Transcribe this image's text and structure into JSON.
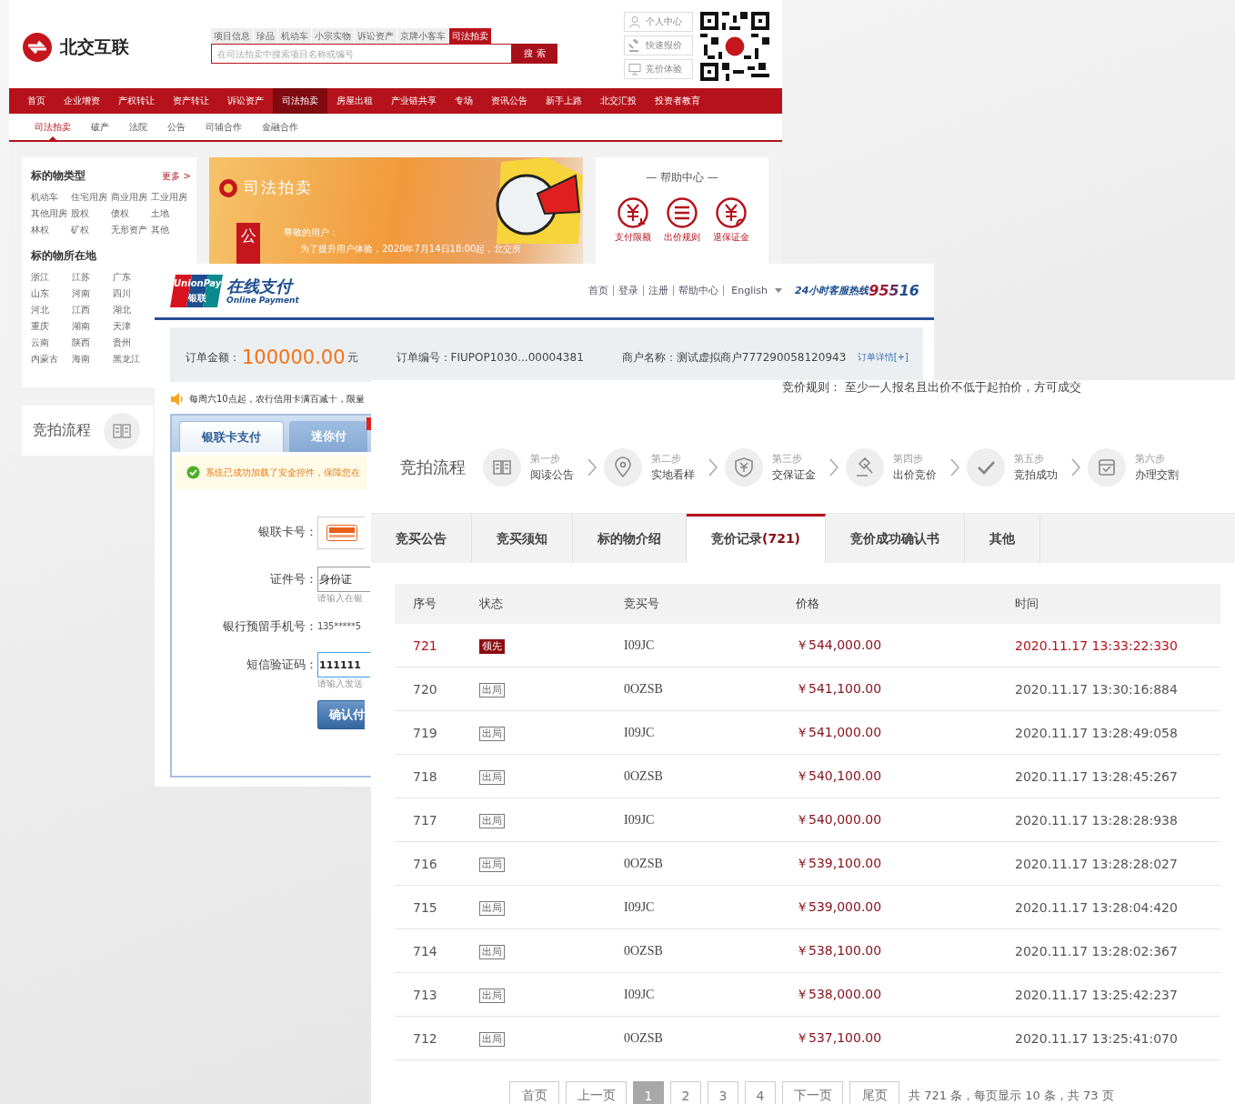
{
  "beijiao": {
    "logo": "北交互联",
    "search_tabs": [
      {
        "label": "项目信息",
        "selected": false
      },
      {
        "label": "珍品",
        "selected": false
      },
      {
        "label": "机动车",
        "selected": false
      },
      {
        "label": "小宗实物",
        "selected": false
      },
      {
        "label": "诉讼资产",
        "selected": false
      },
      {
        "label": "京牌小客车",
        "selected": false
      },
      {
        "label": "司法拍卖",
        "selected": true
      }
    ],
    "search": {
      "placeholder": "在司法拍卖中搜索项目名称或编号",
      "button": "搜 索"
    },
    "user_links": [
      {
        "label": "个人中心",
        "kind": "person"
      },
      {
        "label": "快速报价",
        "kind": "gavel"
      },
      {
        "label": "竞价体验",
        "kind": "monitor"
      }
    ],
    "nav": [
      {
        "label": "首页",
        "selected": false
      },
      {
        "label": "企业增资",
        "selected": false
      },
      {
        "label": "产权转让",
        "selected": false
      },
      {
        "label": "资产转让",
        "selected": false
      },
      {
        "label": "诉讼资产",
        "selected": false
      },
      {
        "label": "司法拍卖",
        "selected": true
      },
      {
        "label": "房屋出租",
        "selected": false
      },
      {
        "label": "产业链共享",
        "selected": false
      },
      {
        "label": "专场",
        "selected": false
      },
      {
        "label": "资讯公告",
        "selected": false
      },
      {
        "label": "新手上路",
        "selected": false
      },
      {
        "label": "北交汇投",
        "selected": false
      },
      {
        "label": "投资者教育",
        "selected": false
      }
    ],
    "subnav": [
      {
        "label": "司法拍卖",
        "selected": true
      },
      {
        "label": "破产",
        "selected": false
      },
      {
        "label": "法院",
        "selected": false
      },
      {
        "label": "公告",
        "selected": false
      },
      {
        "label": "司辅合作",
        "selected": false
      },
      {
        "label": "金融合作",
        "selected": false
      }
    ],
    "sidebar": {
      "types_title": "标的物类型",
      "more": "更多 >",
      "types": [
        "机动车",
        "住宅用房",
        "商业用房",
        "工业用房",
        "其他用房",
        "股权",
        "债权",
        "土地",
        "林权",
        "矿权",
        "无形资产",
        "其他"
      ],
      "location_title": "标的物所在地",
      "locations": [
        "浙江",
        "江苏",
        "广东",
        "山东",
        "河南",
        "四川",
        "河北",
        "江西",
        "湖北",
        "重庆",
        "湖南",
        "天津",
        "云南",
        "陕西",
        "贵州",
        "内蒙古",
        "海南",
        "黑龙江"
      ],
      "process_title": "竞拍流程"
    },
    "banner": {
      "title": "司法拍卖",
      "notice_tag": "公",
      "greeting": "尊敬的用户：",
      "message": "为了提升用户体验，2020年7月14日18:00起，北交所"
    },
    "help": {
      "title": "— 帮助中心 —",
      "items": [
        {
          "label": "支付限额",
          "kind": "yuan-down"
        },
        {
          "label": "出价规则",
          "kind": "list"
        },
        {
          "label": "退保证金",
          "kind": "yuan-return"
        }
      ]
    }
  },
  "unionpay": {
    "logo_brand": "UnionPay",
    "logo_cn": "银联",
    "title": "在线支付",
    "subtitle": "Online Payment",
    "nav": [
      "首页",
      "登录",
      "注册",
      "帮助中心"
    ],
    "language": "English",
    "hotline_label": "24小时客服热线",
    "hotline": "95516",
    "order": {
      "amount_label": "订单金额：",
      "amount": "100000.00",
      "unit": "元",
      "number_label": "订单编号：",
      "number": "FIUPOP1030...00004381",
      "merchant_label": "商户名称：",
      "merchant": "测试虚拟商户777290058120943",
      "details": "订单详情[+]"
    },
    "promo": "每周六10点起，农行信用卡满百减十，限量",
    "pay_tabs": [
      {
        "label": "银联卡支付",
        "selected": true
      },
      {
        "label": "迷你付",
        "selected": false
      }
    ],
    "security_notice": "系统已成功加载了安全控件，保障您在",
    "form": [
      {
        "kind": "card",
        "label": "银联卡号："
      },
      {
        "kind": "input",
        "label": "证件号：",
        "value": "身份证",
        "hint": "请输入在银",
        "focused": false
      },
      {
        "kind": "text",
        "label": "银行预留手机号：",
        "value": "135*****5"
      },
      {
        "kind": "input",
        "label": "短信验证码：",
        "value": "111111",
        "hint": "请输入发送",
        "focused": true
      }
    ],
    "confirm": "确认付"
  },
  "auction": {
    "rule_label": "竞价规则：",
    "rule": "至少一人报名且出价不低于起拍价，方可成交",
    "process_title": "竞拍流程",
    "steps": [
      {
        "step": "第一步",
        "label": "阅读公告",
        "kind": "book"
      },
      {
        "step": "第二步",
        "label": "实地看样",
        "kind": "pin"
      },
      {
        "step": "第三步",
        "label": "交保证金",
        "kind": "shield"
      },
      {
        "step": "第四步",
        "label": "出价竞价",
        "kind": "gavel"
      },
      {
        "step": "第五步",
        "label": "竞拍成功",
        "kind": "check"
      },
      {
        "step": "第六步",
        "label": "办理交割",
        "kind": "box"
      }
    ],
    "tabs": [
      {
        "label": "竞买公告",
        "selected": false
      },
      {
        "label": "竞买须知",
        "selected": false
      },
      {
        "label": "标的物介绍",
        "selected": false
      },
      {
        "label": "竞价记录",
        "count": "(721)",
        "selected": true
      },
      {
        "label": "竞价成功确认书",
        "selected": false
      },
      {
        "label": "其他",
        "selected": false
      }
    ],
    "table": {
      "columns": [
        "序号",
        "状态",
        "竞买号",
        "价格",
        "时间"
      ],
      "rows": [
        {
          "no": "721",
          "status": "领先",
          "leading": true,
          "bidder": "I09JC",
          "price": "￥544,000.00",
          "time": "2020.11.17 13:33:22:330"
        },
        {
          "no": "720",
          "status": "出局",
          "leading": false,
          "bidder": "0OZSB",
          "price": "￥541,100.00",
          "time": "2020.11.17 13:30:16:884"
        },
        {
          "no": "719",
          "status": "出局",
          "leading": false,
          "bidder": "I09JC",
          "price": "￥541,000.00",
          "time": "2020.11.17 13:28:49:058"
        },
        {
          "no": "718",
          "status": "出局",
          "leading": false,
          "bidder": "0OZSB",
          "price": "￥540,100.00",
          "time": "2020.11.17 13:28:45:267"
        },
        {
          "no": "717",
          "status": "出局",
          "leading": false,
          "bidder": "I09JC",
          "price": "￥540,000.00",
          "time": "2020.11.17 13:28:28:938"
        },
        {
          "no": "716",
          "status": "出局",
          "leading": false,
          "bidder": "0OZSB",
          "price": "￥539,100.00",
          "time": "2020.11.17 13:28:28:027"
        },
        {
          "no": "715",
          "status": "出局",
          "leading": false,
          "bidder": "I09JC",
          "price": "￥539,000.00",
          "time": "2020.11.17 13:28:04:420"
        },
        {
          "no": "714",
          "status": "出局",
          "leading": false,
          "bidder": "0OZSB",
          "price": "￥538,100.00",
          "time": "2020.11.17 13:28:02:367"
        },
        {
          "no": "713",
          "status": "出局",
          "leading": false,
          "bidder": "I09JC",
          "price": "￥538,000.00",
          "time": "2020.11.17 13:25:42:237"
        },
        {
          "no": "712",
          "status": "出局",
          "leading": false,
          "bidder": "0OZSB",
          "price": "￥537,100.00",
          "time": "2020.11.17 13:25:41:070"
        }
      ]
    },
    "pagination": {
      "first": "首页",
      "prev": "上一页",
      "pages": [
        {
          "label": "1",
          "selected": true
        },
        {
          "label": "2",
          "selected": false
        },
        {
          "label": "3",
          "selected": false
        },
        {
          "label": "4",
          "selected": false
        }
      ],
      "next": "下一页",
      "last": "尾页",
      "summary": "共 721 条，每页显示 10 条，共 73 页"
    }
  }
}
